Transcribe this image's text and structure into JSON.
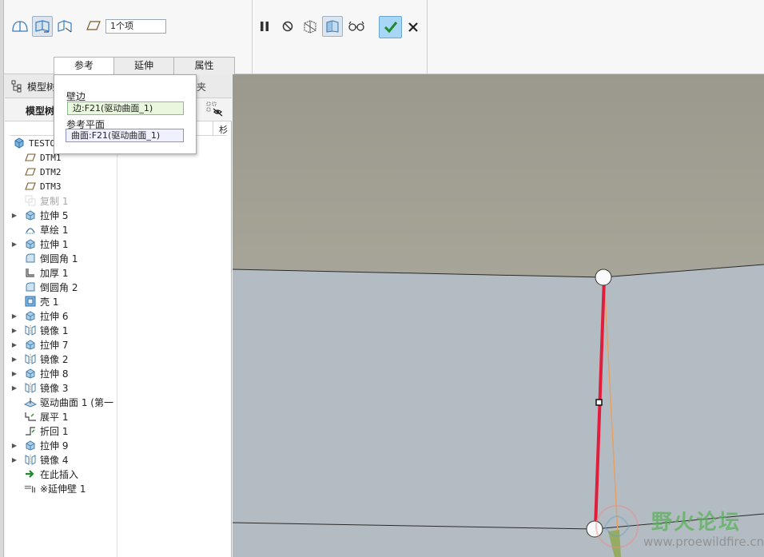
{
  "ribbon": {
    "reference_count": "1个项",
    "tabs": [
      {
        "label": "参考",
        "active": true
      },
      {
        "label": "延伸",
        "active": false
      },
      {
        "label": "属性",
        "active": false
      }
    ],
    "icons": [
      "wall-type-1-icon",
      "wall-type-2-icon",
      "wall-type-3-icon",
      "reference-plane-icon",
      "pause-icon",
      "no-preview-icon",
      "geometry-preview-icon",
      "verify-preview-icon",
      "glasses-icon",
      "confirm-check-icon",
      "cancel-x-icon"
    ],
    "accent": "#a8d6f5"
  },
  "panel": {
    "title": "模型树",
    "title_cut": "模型树",
    "subheader": "模型树",
    "right_tab_fragment": "夹",
    "column_fragment": "杉"
  },
  "popup": {
    "wall_edge_label": "壁边",
    "wall_edge_value": "边:F21(驱动曲面_1)",
    "ref_plane_label": "参考平面",
    "ref_plane_value": "曲面:F21(驱动曲面_1)"
  },
  "tree": {
    "root": "TESTO",
    "items": [
      {
        "label": "DTM1",
        "icon": "datum-plane-icon",
        "expand": false,
        "mono": true,
        "dim": false
      },
      {
        "label": "DTM2",
        "icon": "datum-plane-icon",
        "expand": false,
        "mono": true,
        "dim": false
      },
      {
        "label": "DTM3",
        "icon": "datum-plane-icon",
        "expand": false,
        "mono": true,
        "dim": false
      },
      {
        "label": "复制 1",
        "icon": "copy-icon",
        "expand": false,
        "mono": false,
        "dim": true
      },
      {
        "label": "拉伸 5",
        "icon": "extrude-icon",
        "expand": true,
        "mono": false,
        "dim": false
      },
      {
        "label": "草绘 1",
        "icon": "sketch-icon",
        "expand": false,
        "mono": false,
        "dim": false
      },
      {
        "label": "拉伸 1",
        "icon": "extrude-icon",
        "expand": true,
        "mono": false,
        "dim": false
      },
      {
        "label": "倒圆角 1",
        "icon": "round-icon",
        "expand": false,
        "mono": false,
        "dim": false
      },
      {
        "label": "加厚 1",
        "icon": "thicken-icon",
        "expand": false,
        "mono": false,
        "dim": false
      },
      {
        "label": "倒圆角 2",
        "icon": "round-icon",
        "expand": false,
        "mono": false,
        "dim": false
      },
      {
        "label": "壳 1",
        "icon": "shell-icon",
        "expand": false,
        "mono": false,
        "dim": false
      },
      {
        "label": "拉伸 6",
        "icon": "extrude-icon",
        "expand": true,
        "mono": false,
        "dim": false
      },
      {
        "label": "镜像 1",
        "icon": "mirror-icon",
        "expand": true,
        "mono": false,
        "dim": false
      },
      {
        "label": "拉伸 7",
        "icon": "extrude-icon",
        "expand": true,
        "mono": false,
        "dim": false
      },
      {
        "label": "镜像 2",
        "icon": "mirror-icon",
        "expand": true,
        "mono": false,
        "dim": false
      },
      {
        "label": "拉伸 8",
        "icon": "extrude-icon",
        "expand": true,
        "mono": false,
        "dim": false
      },
      {
        "label": "镜像 3",
        "icon": "mirror-icon",
        "expand": true,
        "mono": false,
        "dim": false
      },
      {
        "label": "驱动曲面 1 (第一",
        "icon": "driving-surface-icon",
        "expand": false,
        "mono": false,
        "dim": false
      },
      {
        "label": "展平 1",
        "icon": "unbend-icon",
        "expand": false,
        "mono": false,
        "dim": false
      },
      {
        "label": "折回 1",
        "icon": "bendback-icon",
        "expand": false,
        "mono": false,
        "dim": false
      },
      {
        "label": "拉伸 9",
        "icon": "extrude-icon",
        "expand": true,
        "mono": false,
        "dim": false
      },
      {
        "label": "镜像 4",
        "icon": "mirror-icon",
        "expand": true,
        "mono": false,
        "dim": false
      },
      {
        "label": "在此插入",
        "icon": "insert-here-arrow-icon",
        "expand": false,
        "mono": false,
        "dim": false
      },
      {
        "label": "※延伸壁 1",
        "icon": "extend-wall-icon",
        "expand": false,
        "mono": false,
        "dim": false
      }
    ]
  },
  "viewport": {
    "colors": {
      "background": "#a8a69b",
      "sheet": "#b3bcc3",
      "edge_selected": "#e01e3c",
      "edge_preview": "#e8a060"
    }
  },
  "watermark": {
    "title": "野火论坛",
    "url": "www.proewildfire.cn"
  }
}
